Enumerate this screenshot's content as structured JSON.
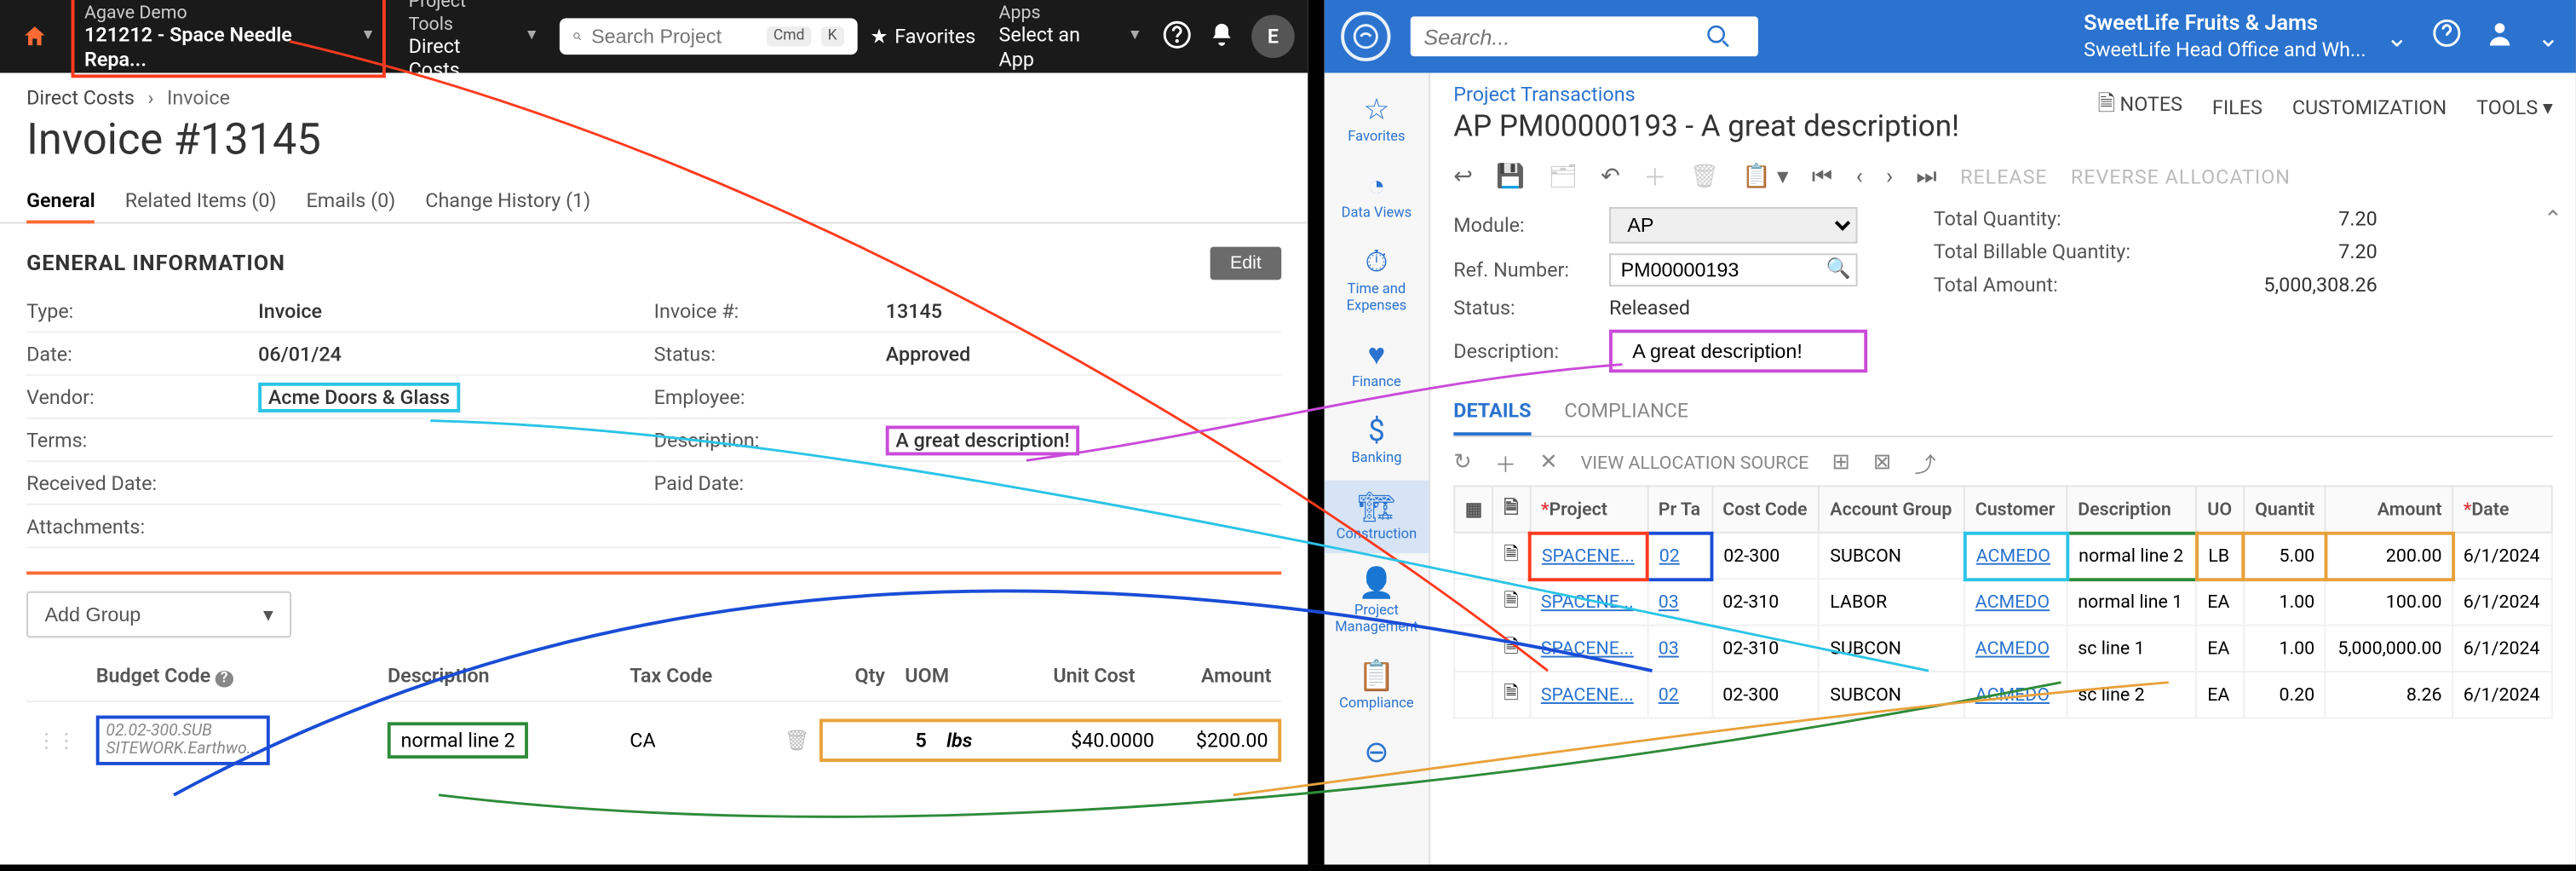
{
  "left": {
    "topbar": {
      "project_label": "Agave Demo",
      "project_value": "121212 - Space Needle Repa...",
      "tools_label": "Project Tools",
      "tools_value": "Direct Costs",
      "search_placeholder": "Search Project",
      "kbd1": "Cmd",
      "kbd2": "K",
      "favorites": "Favorites",
      "apps_label": "Apps",
      "apps_value": "Select an App",
      "avatar": "E"
    },
    "crumbs": {
      "a": "Direct Costs",
      "b": "Invoice"
    },
    "title": "Invoice #13145",
    "tabs": [
      "General",
      "Related Items (0)",
      "Emails (0)",
      "Change History (1)"
    ],
    "section_title": "GENERAL INFORMATION",
    "edit": "Edit",
    "fields": {
      "type_l": "Type:",
      "type_v": "Invoice",
      "invno_l": "Invoice #:",
      "invno_v": "13145",
      "date_l": "Date:",
      "date_v": "06/01/24",
      "status_l": "Status:",
      "status_v": "Approved",
      "vendor_l": "Vendor:",
      "vendor_v": "Acme Doors & Glass",
      "employee_l": "Employee:",
      "terms_l": "Terms:",
      "desc_l": "Description:",
      "desc_v": "A great description!",
      "recv_l": "Received Date:",
      "paid_l": "Paid Date:",
      "attach_l": "Attachments:"
    },
    "add_group": "Add Group",
    "cols": {
      "budget": "Budget Code",
      "desc": "Description",
      "tax": "Tax Code",
      "qty": "Qty",
      "uom": "UOM",
      "unit": "Unit Cost",
      "amt": "Amount"
    },
    "line": {
      "budget1": "02.02-300.SUB",
      "budget2": "SITEWORK.Earthwo...",
      "desc": "normal line 2",
      "tax": "CA",
      "qty": "5",
      "uom": "lbs",
      "unit": "$40.0000",
      "amt": "$200.00"
    }
  },
  "right": {
    "search_placeholder": "Search...",
    "company1": "SweetLife Fruits & Jams",
    "company2": "SweetLife Head Office and Wh...",
    "side": [
      "Favorites",
      "Data Views",
      "Time and Expenses",
      "Finance",
      "Banking",
      "Construction",
      "Project Management",
      "Compliance"
    ],
    "bc": "Project Transactions",
    "title": "AP PM00000193 - A great description!",
    "actions": {
      "notes": "NOTES",
      "files": "FILES",
      "cust": "CUSTOMIZATION",
      "tools": "TOOLS"
    },
    "toolbar": {
      "release": "RELEASE",
      "reverse": "REVERSE ALLOCATION"
    },
    "form": {
      "module_l": "Module:",
      "module_v": "AP",
      "ref_l": "Ref. Number:",
      "ref_v": "PM00000193",
      "status_l": "Status:",
      "status_v": "Released",
      "desc_l": "Description:",
      "desc_v": "A great description!",
      "tq_l": "Total Quantity:",
      "tq_v": "7.20",
      "tbq_l": "Total Billable Quantity:",
      "tbq_v": "7.20",
      "ta_l": "Total Amount:",
      "ta_v": "5,000,308.26"
    },
    "tabs2": {
      "details": "DETAILS",
      "compliance": "COMPLIANCE"
    },
    "allo": "VIEW ALLOCATION SOURCE",
    "gcols": {
      "proj": "Project",
      "pt": "Pr Ta",
      "cc": "Cost Code",
      "ag": "Account Group",
      "cust": "Customer",
      "desc": "Description",
      "uom": "UO",
      "qty": "Quantit",
      "amt": "Amount",
      "date": "Date"
    },
    "rows": [
      {
        "proj": "SPACENE...",
        "pt": "02",
        "cc": "02-300",
        "ag": "SUBCON",
        "cust": "ACMEDO",
        "desc": "normal line 2",
        "uom": "LB",
        "qty": "5.00",
        "amt": "200.00",
        "date": "6/1/2024"
      },
      {
        "proj": "SPACENE...",
        "pt": "03",
        "cc": "02-310",
        "ag": "LABOR",
        "cust": "ACMEDO",
        "desc": "normal line 1",
        "uom": "EA",
        "qty": "1.00",
        "amt": "100.00",
        "date": "6/1/2024"
      },
      {
        "proj": "SPACENE...",
        "pt": "03",
        "cc": "02-310",
        "ag": "SUBCON",
        "cust": "ACMEDO",
        "desc": "sc line 1",
        "uom": "EA",
        "qty": "1.00",
        "amt": "5,000,000.00",
        "date": "6/1/2024"
      },
      {
        "proj": "SPACENE...",
        "pt": "02",
        "cc": "02-300",
        "ag": "SUBCON",
        "cust": "ACMEDO",
        "desc": "sc line 2",
        "uom": "EA",
        "qty": "0.20",
        "amt": "8.26",
        "date": "6/1/2024"
      }
    ]
  }
}
